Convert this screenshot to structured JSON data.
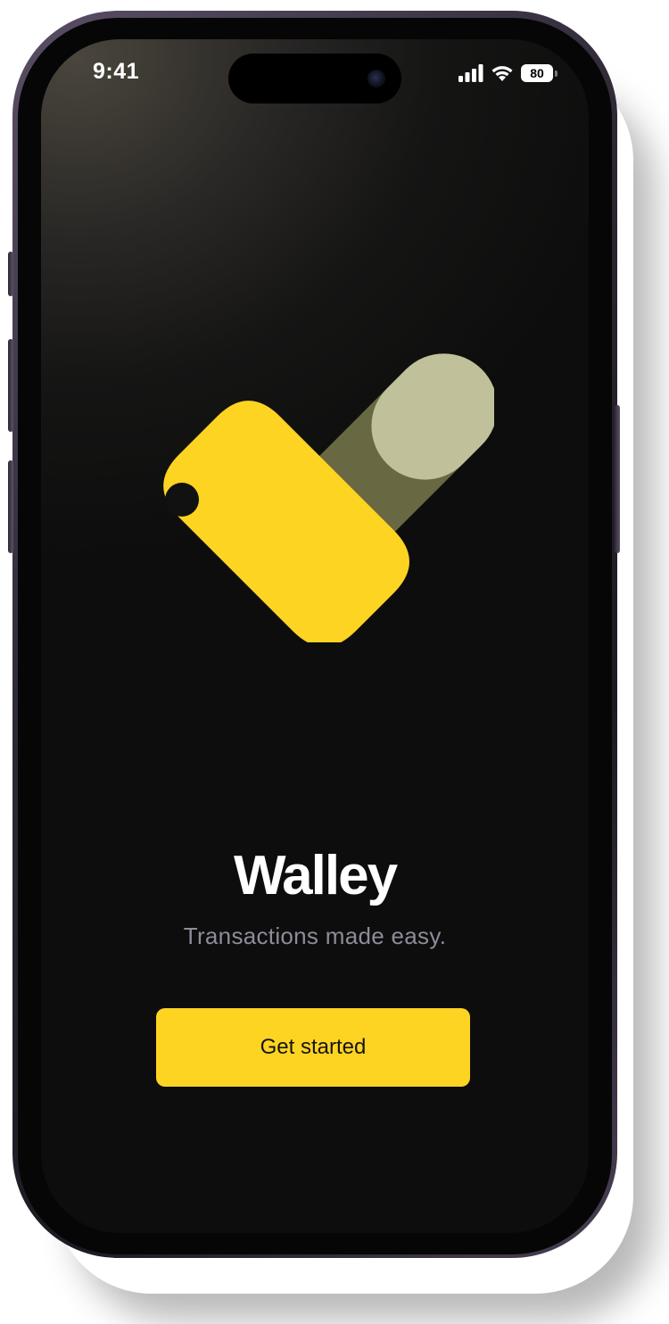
{
  "status_bar": {
    "time": "9:41",
    "battery_level": "80",
    "icons": [
      "signal-icon",
      "wifi-icon",
      "battery-icon"
    ]
  },
  "app": {
    "name": "Walley",
    "tagline": "Transactions made easy.",
    "cta_label": "Get started",
    "logo_icon": "wallet-heart-logo"
  },
  "colors": {
    "brand_yellow": "#fed422",
    "logo_olive_dark": "#686842",
    "logo_olive_light": "#c0c09a",
    "background": "#0d0d0d",
    "tagline_gray": "#8e8c99"
  }
}
